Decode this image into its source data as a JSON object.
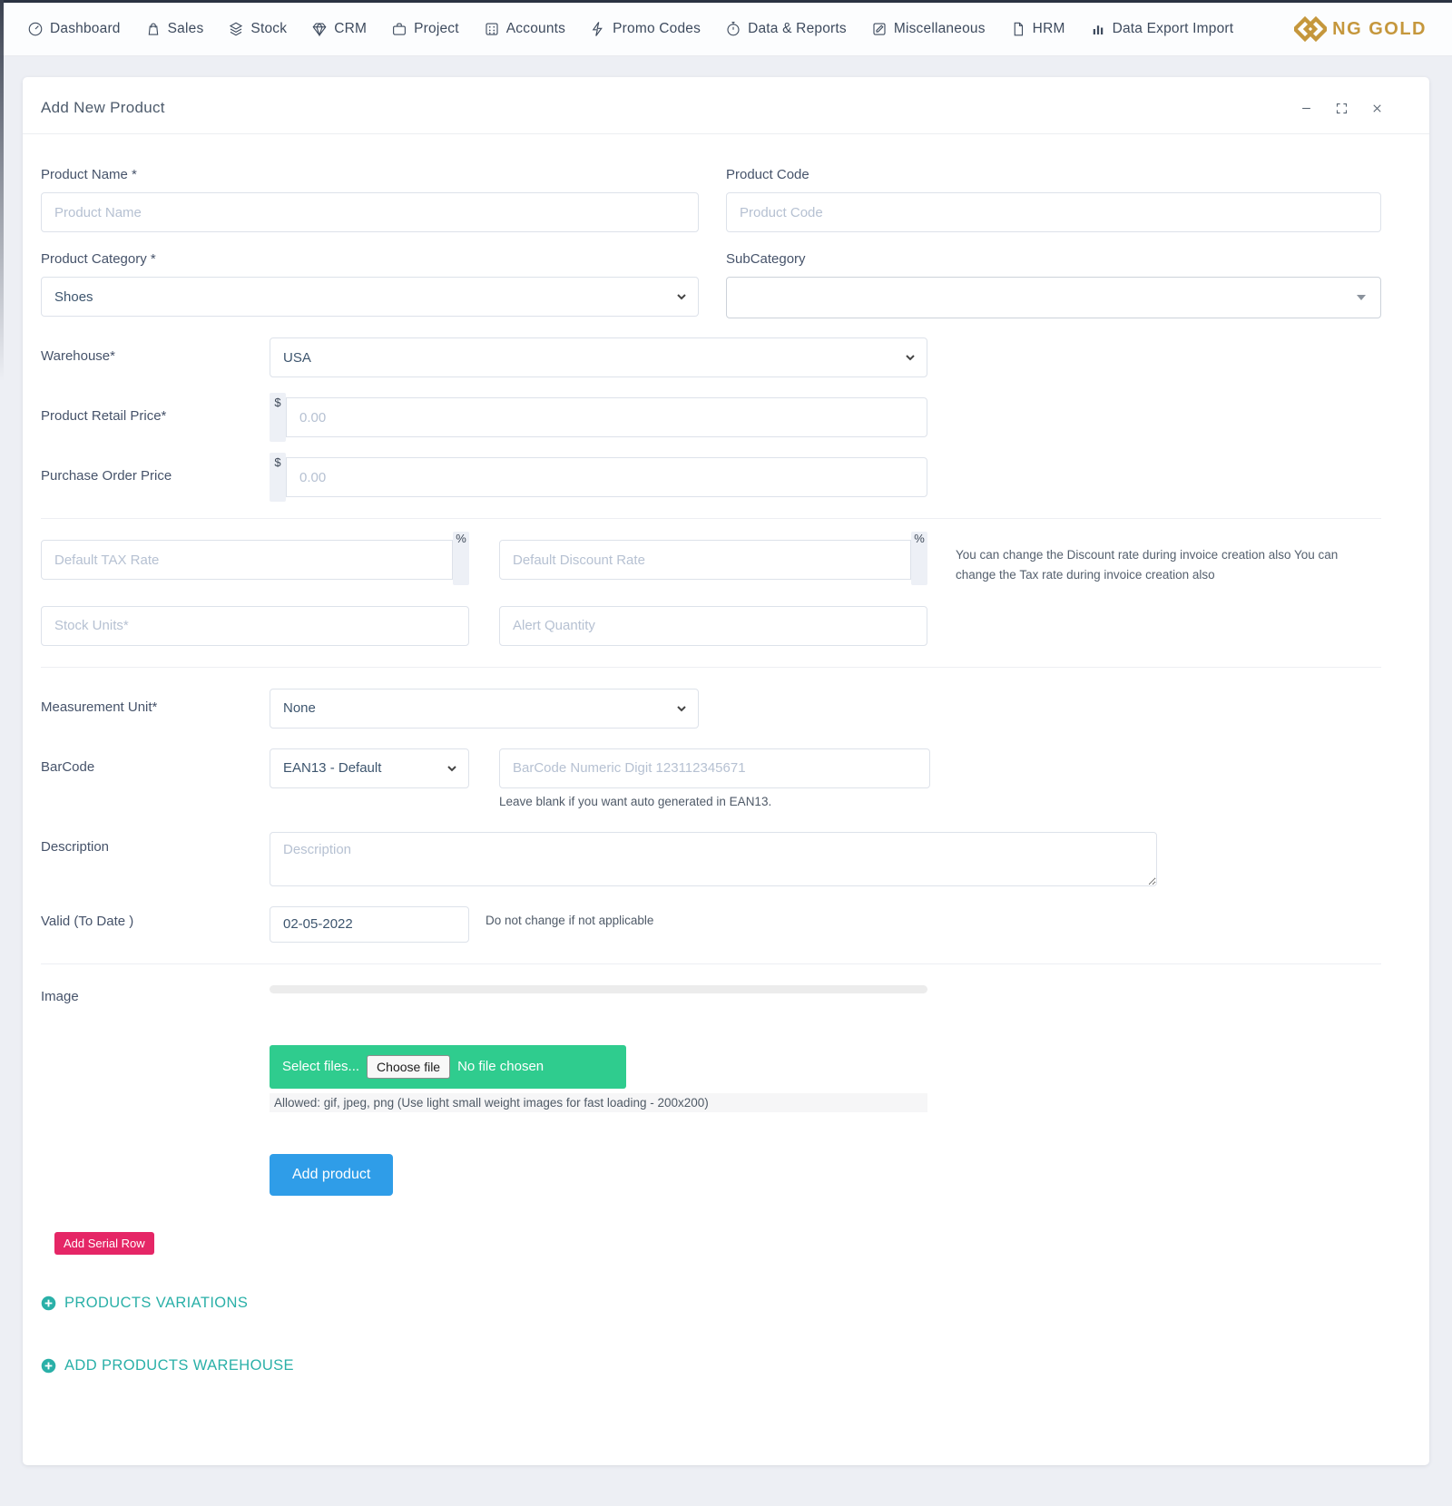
{
  "nav": {
    "items": [
      {
        "label": "Dashboard",
        "icon": "speedometer-icon"
      },
      {
        "label": "Sales",
        "icon": "shopping-bag-icon"
      },
      {
        "label": "Stock",
        "icon": "layers-icon"
      },
      {
        "label": "CRM",
        "icon": "gem-icon"
      },
      {
        "label": "Project",
        "icon": "briefcase-icon"
      },
      {
        "label": "Accounts",
        "icon": "grid-dots-icon"
      },
      {
        "label": "Promo Codes",
        "icon": "lightning-icon"
      },
      {
        "label": "Data & Reports",
        "icon": "stopwatch-icon"
      },
      {
        "label": "Miscellaneous",
        "icon": "edit-square-icon"
      },
      {
        "label": "HRM",
        "icon": "document-icon"
      },
      {
        "label": "Data Export Import",
        "icon": "bar-chart-icon"
      }
    ],
    "brand": "NG GOLD"
  },
  "modal": {
    "title": "Add New Product"
  },
  "form": {
    "product_name": {
      "label": "Product Name *",
      "placeholder": "Product Name"
    },
    "product_code": {
      "label": "Product Code",
      "placeholder": "Product Code"
    },
    "product_category": {
      "label": "Product Category *",
      "value": "Shoes"
    },
    "subcategory": {
      "label": "SubCategory"
    },
    "warehouse": {
      "label": "Warehouse*",
      "value": "USA"
    },
    "retail_price": {
      "label": "Product Retail Price*",
      "currency": "$",
      "placeholder": "0.00"
    },
    "purchase_price": {
      "label": "Purchase Order Price",
      "currency": "$",
      "placeholder": "0.00"
    },
    "tax_rate": {
      "placeholder": "Default TAX Rate",
      "unit": "%"
    },
    "discount_rate": {
      "placeholder": "Default Discount Rate",
      "unit": "%"
    },
    "rates_note": "You can change the Discount rate during invoice creation also You can change the Tax rate during invoice creation also",
    "stock_units": {
      "placeholder": "Stock Units*"
    },
    "alert_quantity": {
      "placeholder": "Alert Quantity"
    },
    "measurement_unit": {
      "label": "Measurement Unit*",
      "value": "None"
    },
    "barcode": {
      "label": "BarCode",
      "format": "EAN13 - Default",
      "placeholder": "BarCode Numeric Digit 123112345671",
      "note": "Leave blank if you want auto generated in EAN13."
    },
    "description": {
      "label": "Description",
      "placeholder": "Description"
    },
    "valid_to_date": {
      "label": "Valid (To Date )",
      "value": "02-05-2022",
      "note": "Do not change if not applicable"
    },
    "image": {
      "label": "Image",
      "button_label": "Select files...",
      "choose_file_label": "Choose file",
      "file_status": "No file chosen",
      "note": "Allowed: gif, jpeg, png (Use light small weight images for fast loading - 200x200)"
    },
    "buttons": {
      "add_product": "Add product",
      "add_serial_row": "Add Serial Row"
    },
    "links": {
      "products_variations": "PRODUCTS VARIATIONS",
      "add_products_warehouse": "ADD PRODUCTS WAREHOUSE"
    }
  },
  "colors": {
    "accent_blue": "#2f9de8",
    "accent_green": "#2fcc8e",
    "accent_pink": "#e52666",
    "accent_teal": "#2ab0a8",
    "brand_gold": "#c5973c"
  }
}
